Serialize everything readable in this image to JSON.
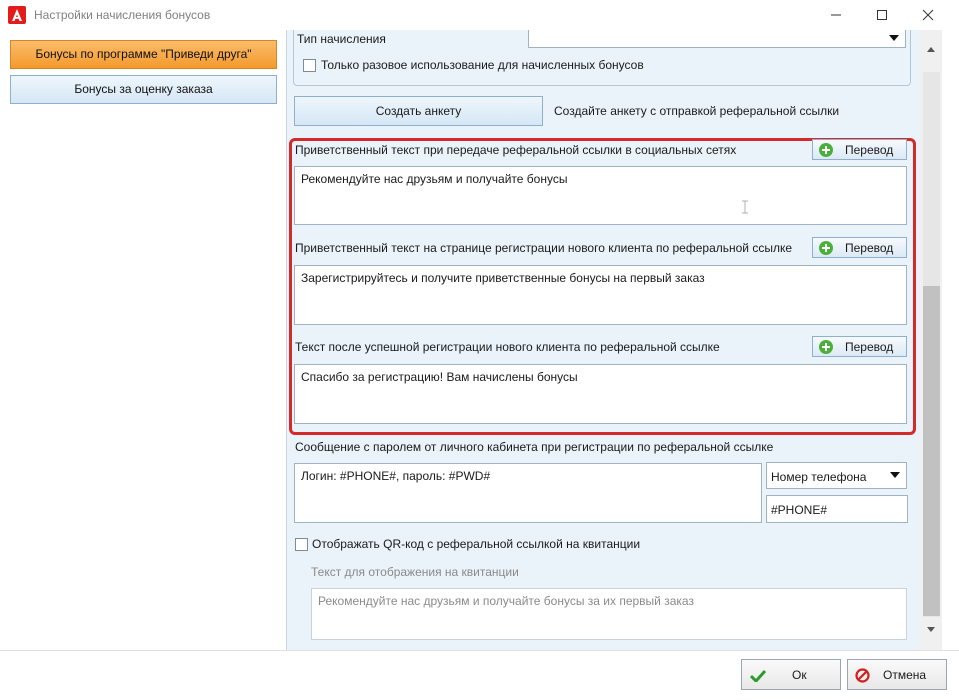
{
  "window": {
    "title": "Настройки начисления бонусов"
  },
  "nav": {
    "items": [
      {
        "label": "Бонусы по программе \"Приведи друга\"",
        "active": true
      },
      {
        "label": "Бонусы за оценку заказа",
        "active": false
      }
    ]
  },
  "top_group": {
    "accrual_type_label": "Тип начисления",
    "accrual_type_value": "",
    "one_time_checkbox_label": "Только разовое использование для начисленных бонусов",
    "one_time_checked": false
  },
  "survey": {
    "button_label": "Создать анкету",
    "hint": "Создайте анкету с отправкой реферальной ссылки"
  },
  "texts": {
    "social": {
      "label": "Приветственный текст при передаче реферальной ссылки в социальных сетях",
      "value": "Рекомендуйте нас друзьям и получайте бонусы"
    },
    "registration_page": {
      "label": "Приветственный текст на странице регистрации нового клиента по реферальной ссылке",
      "value": "Зарегистрируйтесь и получите приветственные бонусы на первый заказ"
    },
    "after_registration": {
      "label": "Текст после успешной регистрации нового клиента по реферальной ссылке",
      "value": "Спасибо за регистрацию! Вам начислены бонусы"
    },
    "translate_label": "Перевод"
  },
  "password_message": {
    "label": "Сообщение с паролем от личного кабинета при регистрации по реферальной ссылке",
    "value": "Логин: #PHONE#, пароль: #PWD#",
    "field_select": "Номер телефона",
    "field_token": "#PHONE#"
  },
  "qr": {
    "checkbox_label": "Отображать QR-код с реферальной ссылкой на квитанции",
    "checked": false,
    "receipt_text_label": "Текст для отображения на квитанции",
    "receipt_text_value": "Рекомендуйте нас друзьям и получайте бонусы за их первый заказ"
  },
  "dialog": {
    "ok_label": "Ок",
    "cancel_label": "Отмена"
  },
  "colors": {
    "highlight_box": "#d42a2a",
    "active_nav": "#f49a2c",
    "panel_bg": "#eaf3fa"
  }
}
